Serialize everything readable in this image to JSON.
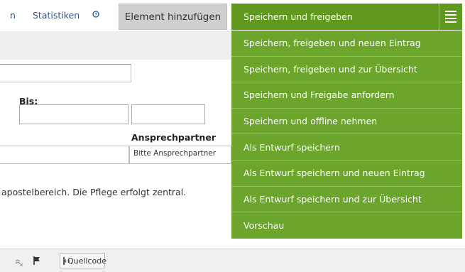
{
  "tabs": {
    "partial": "n",
    "statistiken": "Statistiken"
  },
  "add_element_label": "Element hinzufügen",
  "save_menu": {
    "main_label": "Speichern und freigeben",
    "items": [
      "Speichern, freigeben und neuen Eintrag",
      "Speichern, freigeben und zur Übersicht",
      "Speichern und Freigabe anfordern",
      "Speichern und offline nehmen",
      "Als Entwurf speichern",
      "Als Entwurf speichern und neuen Eintrag",
      "Als Entwurf speichern und zur Übersicht",
      "Vorschau"
    ]
  },
  "form": {
    "bis_label": "Bis:",
    "ansprechpartner_label": "Ansprechpartner",
    "ansprechpartner_value": "Bitte Ansprechpartner"
  },
  "info_text": "apostelbereich. Die Pflege erfolgt zentral.",
  "toolbar": {
    "quellcode_label": "Quellcode"
  },
  "colors": {
    "menu_main": "#5f9a1f",
    "menu_item": "#6ba52c",
    "tab_link": "#2a5590"
  },
  "icons": [
    "clock-icon",
    "hamburger-menu-icon",
    "spellcheck-icon",
    "flag-icon",
    "source-code-icon"
  ]
}
